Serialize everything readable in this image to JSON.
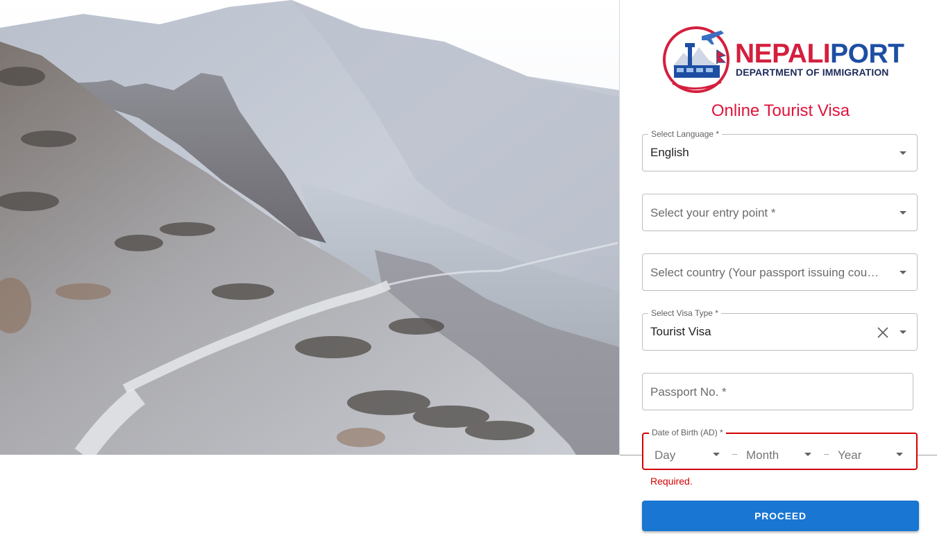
{
  "brand": {
    "name_part1": "NEPALI",
    "name_part2": "PORT",
    "subtitle": "DEPARTMENT OF IMMIGRATION",
    "color_red": "#d41f3e",
    "color_blue": "#1d4ea3"
  },
  "page_title": "Online Tourist Visa",
  "form": {
    "language": {
      "label": "Select Language *",
      "value": "English"
    },
    "entry_point": {
      "placeholder": "Select your entry point *"
    },
    "country": {
      "placeholder": "Select country (Your passport issuing country) *"
    },
    "visa_type": {
      "label": "Select Visa Type *",
      "value": "Tourist Visa"
    },
    "passport": {
      "placeholder": "Passport No. *"
    },
    "dob": {
      "label": "Date of Birth (AD) *",
      "day_placeholder": "Day",
      "month_placeholder": "Month",
      "year_placeholder": "Year",
      "separator": "–",
      "error": "Required."
    },
    "proceed_label": "PROCEED"
  },
  "colors": {
    "primary": "#1976d2",
    "error": "#d50000",
    "title": "#e0143c"
  },
  "icons": {
    "dropdown": "chevron-down-icon",
    "clear": "close-icon"
  }
}
